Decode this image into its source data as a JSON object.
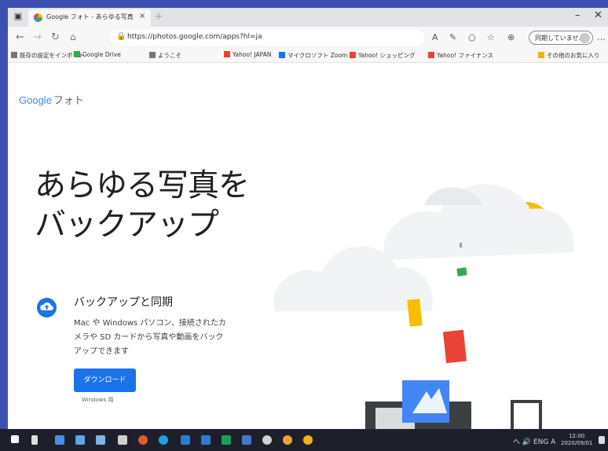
{
  "browser": {
    "tab_title": "Google フォト - あらゆる写真をバックアップ",
    "tab_close": "×",
    "new_tab": "+",
    "url": "https://photos.google.com/apps?hl=ja",
    "profile_label": "同期していません",
    "window_controls": [
      "–",
      "✕"
    ]
  },
  "bookmarks": [
    {
      "label": "既存の設定をインポート",
      "color": "#777"
    },
    {
      "label": "Google Drive",
      "color": "#34a853"
    },
    {
      "label": "ようこそ",
      "color": "#777"
    },
    {
      "label": "Yahoo! JAPAN",
      "color": "#ea4335"
    },
    {
      "label": "マイクロソフト Zoom",
      "color": "#1a73e8"
    },
    {
      "label": "Yahoo! ショッピング",
      "color": "#ea4335"
    },
    {
      "label": "Yahoo! ファイナンス",
      "color": "#ea4335"
    },
    {
      "label": "その他のお気に入り",
      "color": "#f1b200"
    }
  ],
  "page": {
    "logo_text": "Google",
    "logo_suffix": "フォト",
    "hero_line1": "あらゆる写真を",
    "hero_line2": "バックアップ",
    "feature_title": "バックアップと同期",
    "feature_desc": "Mac や Windows パソコン、接続されたカメラや SD カードから写真や動画をバックアップできます",
    "download_button": "ダウンロード",
    "download_sub": "Windows 用"
  },
  "taskbar": {
    "tray_text": "へ 🔊 ENG A",
    "time": "12:00",
    "date": "2020/09/01"
  },
  "colors": {
    "accent": "#1a73e8",
    "taskbar": "#1d1f2b",
    "frame": "#3c50b2"
  }
}
